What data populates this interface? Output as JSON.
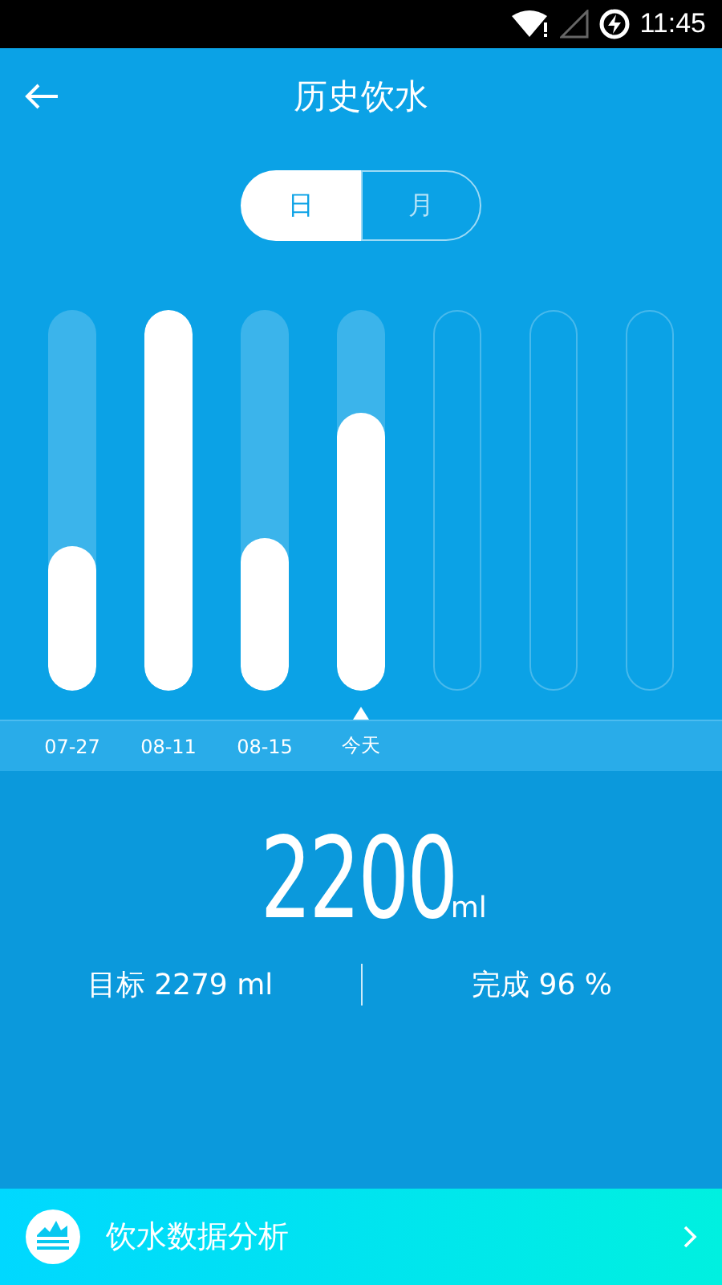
{
  "status_bar": {
    "time": "11:45"
  },
  "header": {
    "title": "历史饮水"
  },
  "tabs": [
    {
      "label": "日",
      "selected": true
    },
    {
      "label": "月",
      "selected": false
    }
  ],
  "bars": [
    {
      "kind": "filled",
      "label": "07-27",
      "level": 0.38,
      "selected": false
    },
    {
      "kind": "filled",
      "label": "08-11",
      "level": 1.0,
      "selected": false
    },
    {
      "kind": "filled",
      "label": "08-15",
      "level": 0.4,
      "selected": false
    },
    {
      "kind": "filled",
      "label": "今天",
      "level": 0.73,
      "selected": true
    },
    {
      "kind": "empty"
    },
    {
      "kind": "empty"
    },
    {
      "kind": "empty"
    }
  ],
  "total": {
    "value": "2200",
    "unit": "ml"
  },
  "stats": [
    {
      "text": "目标 2279 ml"
    },
    {
      "text": "完成 96 %"
    }
  ],
  "footer": {
    "label": "饮水数据分析"
  }
}
